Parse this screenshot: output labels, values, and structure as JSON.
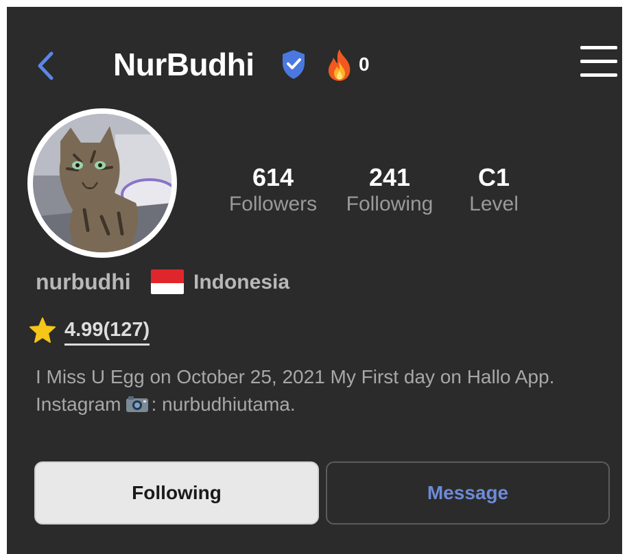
{
  "header": {
    "title": "NurBudhi",
    "streak_count": "0",
    "icons": [
      "chevron-left-icon",
      "verified-shield-icon",
      "fire-icon",
      "hamburger-menu-icon"
    ],
    "accent_color": "#5b86e5"
  },
  "profile": {
    "username": "nurbudhi",
    "country": "Indonesia",
    "rating": "4.99(127)",
    "bio_line1": "I Miss U Egg  on October 25, 2021 My First day on Hallo App.",
    "bio_line2_prefix": "Instagram",
    "bio_line2_suffix": ": nurbudhiutama."
  },
  "stats": [
    {
      "value": "614",
      "label": "Followers"
    },
    {
      "value": "241",
      "label": "Following"
    },
    {
      "value": "C1",
      "label": "Level"
    }
  ],
  "actions": {
    "following_label": "Following",
    "message_label": "Message"
  }
}
